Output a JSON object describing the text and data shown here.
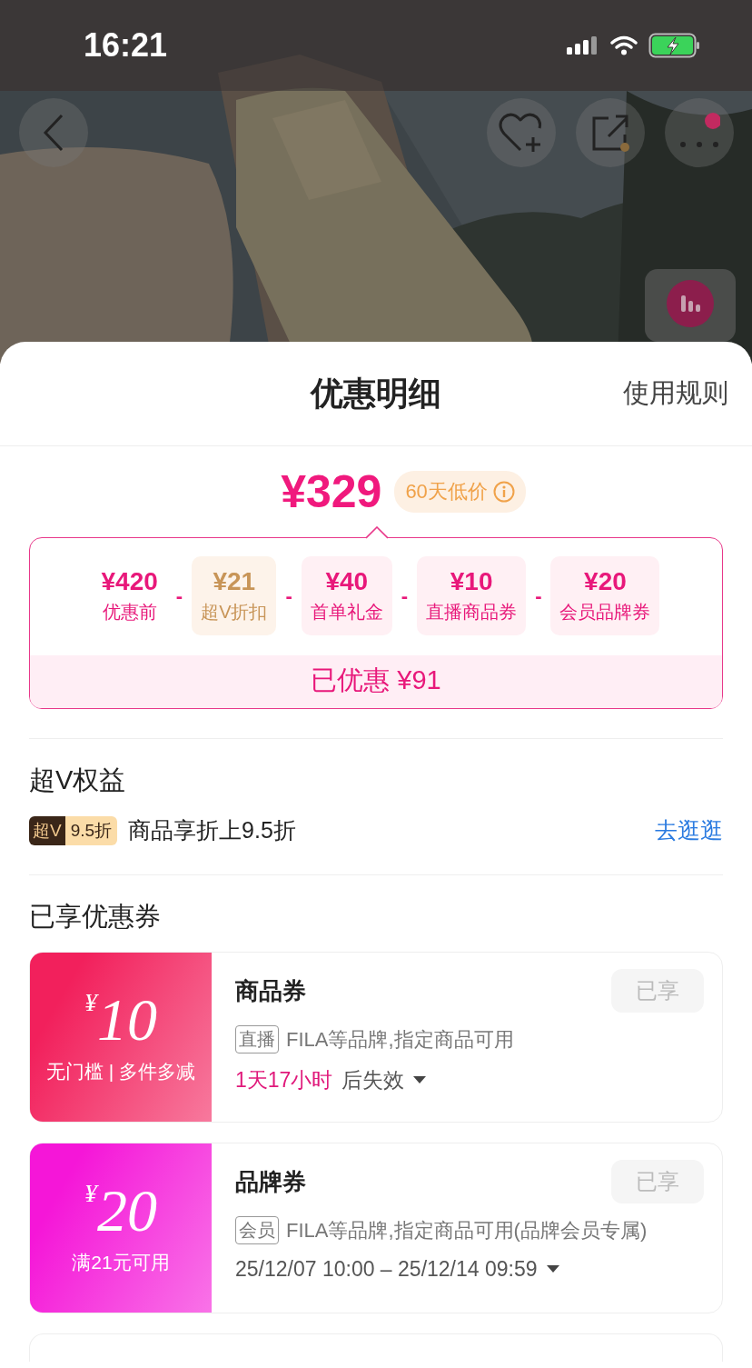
{
  "status_bar": {
    "time": "16:21"
  },
  "sheet": {
    "title": "优惠明细",
    "rules_link": "使用规则"
  },
  "price": {
    "final": "¥329",
    "badge": "60天低价"
  },
  "breakdown": {
    "items": [
      {
        "amount": "¥420",
        "label": "优惠前",
        "kind": "original"
      },
      {
        "operator": "-",
        "amount": "¥21",
        "label": "超V折扣",
        "kind": "vip"
      },
      {
        "operator": "-",
        "amount": "¥40",
        "label": "首单礼金",
        "kind": "discount"
      },
      {
        "operator": "-",
        "amount": "¥10",
        "label": "直播商品券",
        "kind": "discount"
      },
      {
        "operator": "-",
        "amount": "¥20",
        "label": "会员品牌券",
        "kind": "discount"
      }
    ],
    "total_label": "已优惠",
    "total": "¥91"
  },
  "super_v": {
    "title": "超V权益",
    "badge_main": "超V",
    "badge_rate": "9.5折",
    "text": "商品享折上9.5折",
    "link": "去逛逛"
  },
  "coupons": {
    "title": "已享优惠券",
    "items": [
      {
        "color": "#f2205c",
        "symbol": "¥",
        "amount": "10",
        "condition": "无门槛 | 多件多减",
        "name": "商品券",
        "status": "已享",
        "tag": "直播",
        "desc": "FILA等品牌,指定商品可用",
        "countdown": "1天17小时",
        "validity": "后失效"
      },
      {
        "color": "#f516d8",
        "symbol": "¥",
        "amount": "20",
        "condition": "满21元可用",
        "name": "品牌券",
        "status": "已享",
        "tag": "会员",
        "desc": "FILA等品牌,指定商品可用(品牌会员专属)",
        "validity": "25/12/07 10:00 – 25/12/14 09:59"
      }
    ]
  }
}
